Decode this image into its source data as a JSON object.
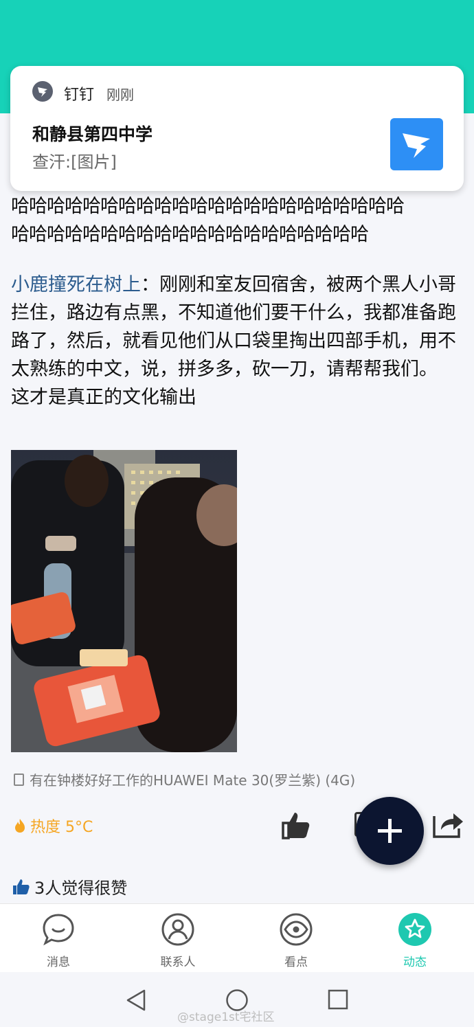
{
  "notification": {
    "app_name": "钉钉",
    "time": "刚刚",
    "title": "和静县第四中学",
    "body": "查汗:[图片]",
    "accent": "#2d8ff5"
  },
  "post": {
    "ha_line_1": "哈哈哈哈哈哈哈哈哈哈哈哈哈哈哈哈哈哈哈哈哈哈",
    "ha_line_2": "哈哈哈哈哈哈哈哈哈哈哈哈哈哈哈哈哈哈哈哈",
    "author": "小鹿撞死在树上",
    "separator": "：",
    "text": "刚刚和室友回宿舍，被两个黑人小哥拦住，路边有点黑，不知道他们要干什么，我都准备跑路了，然后，就看见他们从口袋里掏出四部手机，用不太熟练的中文，说，拼多多，砍一刀，请帮帮我们。",
    "text_2": "这才是真正的文化输出"
  },
  "device": {
    "icon": "phone-icon",
    "text": "有在钟楼好好工作的HUAWEI Mate 30(罗兰紫) (4G)"
  },
  "heat": {
    "icon": "flame-icon",
    "text": "热度 5°C",
    "color": "#f5a623"
  },
  "likes": {
    "icon": "thumb-up-icon",
    "text": "3人觉得很赞"
  },
  "bottom_nav": {
    "items": [
      {
        "label": "消息",
        "icon": "chat-bubble-icon",
        "active": false
      },
      {
        "label": "联系人",
        "icon": "person-icon",
        "active": false
      },
      {
        "label": "看点",
        "icon": "eye-icon",
        "active": false
      },
      {
        "label": "动态",
        "icon": "star-icon",
        "active": true
      }
    ],
    "active_color": "#1ec8b0"
  },
  "system_nav": {
    "back_icon": "back-triangle-icon",
    "home_icon": "home-circle-icon",
    "recents_icon": "recents-square-icon"
  },
  "watermark": "@stage1st宅社区",
  "colors": {
    "header": "#17d2b8",
    "fab": "#0c1530",
    "author_link": "#2c5c8e"
  }
}
